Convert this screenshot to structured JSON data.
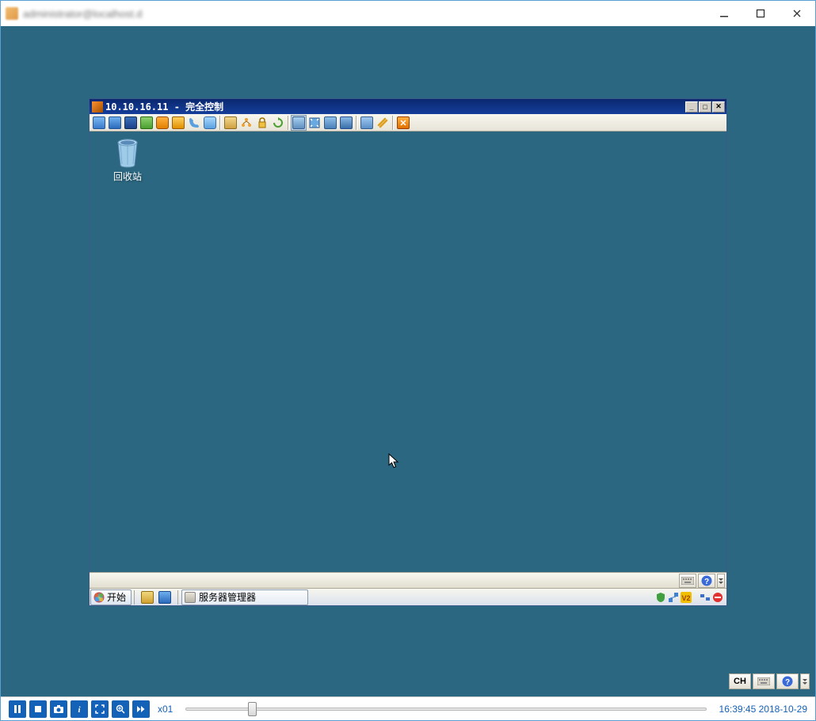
{
  "appWindow": {
    "title": "administrator@localhost.d"
  },
  "remoteWindow": {
    "ip": "10.10.16.11",
    "sep": " - ",
    "mode": "完全控制"
  },
  "desktop": {
    "recycleBin": "回收站"
  },
  "taskbar": {
    "start": "开始",
    "runningApp": "服务器管理器"
  },
  "miniStatus": {
    "ime": "CH"
  },
  "playbar": {
    "speed": "x01",
    "time": "16:39:45",
    "date": "2018-10-29"
  }
}
